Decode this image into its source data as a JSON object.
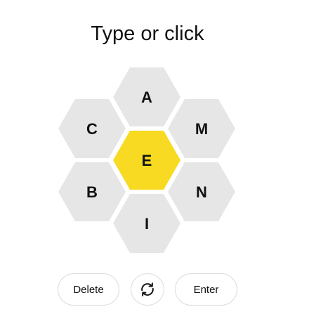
{
  "prompt": "Type or click",
  "center_color": "#f7da21",
  "outer_color": "#e6e6e6",
  "letters": {
    "center": "E",
    "top": "A",
    "upper_left": "C",
    "upper_right": "M",
    "lower_left": "B",
    "lower_right": "N",
    "bottom": "I"
  },
  "controls": {
    "delete_label": "Delete",
    "shuffle_icon": "shuffle-arrows-icon",
    "enter_label": "Enter"
  }
}
